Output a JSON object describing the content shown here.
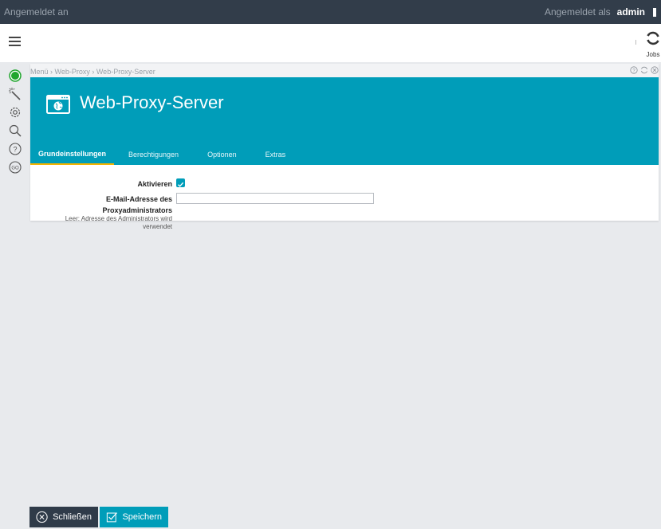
{
  "topbar": {
    "status": "Angemeldet an",
    "logged_in_as": "Angemeldet als",
    "user": "admin"
  },
  "header": {
    "jobs_label": "Jobs"
  },
  "panel": {
    "breadcrumb": "Menü › Web-Proxy › Web-Proxy-Server",
    "title": "Web-Proxy-Server",
    "tabs": [
      "Grundeinstellungen",
      "Berechtigungen",
      "Optionen",
      "Extras"
    ],
    "active_tab": "Grundeinstellungen"
  },
  "form": {
    "activate_label": "Aktivieren",
    "activate_checked": true,
    "email_label_line1": "E-Mail-Adresse des",
    "email_label_line2": "Proxyadministrators",
    "email_hint_line1": "Leer: Adresse des Administrators wird",
    "email_hint_line2": "verwendet",
    "email_value": ""
  },
  "buttons": {
    "close": "Schließen",
    "save": "Speichern"
  },
  "colors": {
    "topbar": "#323d4a",
    "accent": "#009db9",
    "tab_underline": "#f4b400",
    "status_green": "#21a62e"
  }
}
